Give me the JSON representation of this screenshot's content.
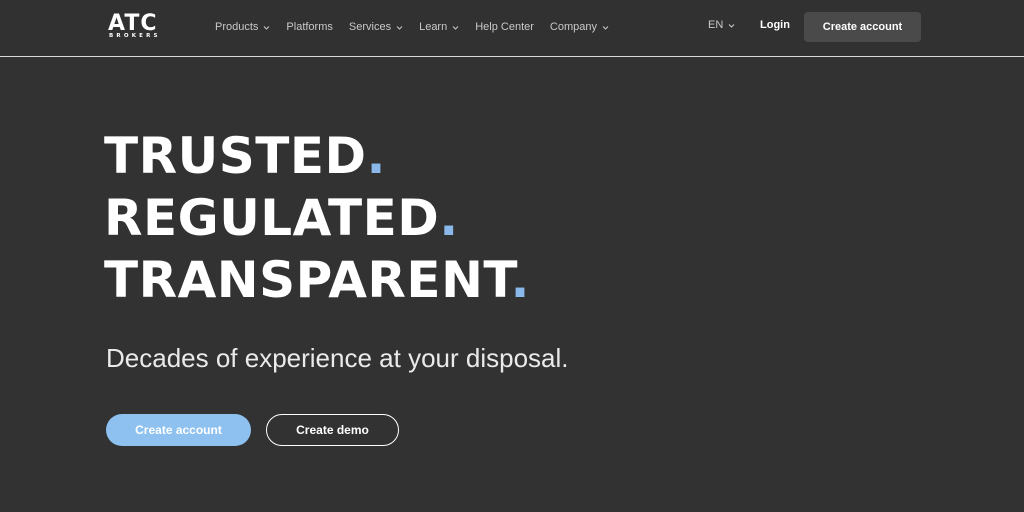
{
  "header": {
    "logo": {
      "main": "ATC",
      "sub": "BROKERS"
    },
    "nav": [
      {
        "label": "Products",
        "has_dropdown": true
      },
      {
        "label": "Platforms",
        "has_dropdown": false
      },
      {
        "label": "Services",
        "has_dropdown": true
      },
      {
        "label": "Learn",
        "has_dropdown": true
      },
      {
        "label": "Help Center",
        "has_dropdown": false
      },
      {
        "label": "Company",
        "has_dropdown": true
      }
    ],
    "language": "EN",
    "login_label": "Login",
    "cta_label": "Create account"
  },
  "hero": {
    "lines": [
      "TRUSTED",
      "REGULATED",
      "TRANSPARENT"
    ],
    "subtitle": "Decades of experience at your disposal.",
    "primary_button": "Create account",
    "secondary_button": "Create demo"
  },
  "colors": {
    "background": "#323232",
    "accent_dot": "#8ab8ea",
    "primary_button": "#8ec1ef",
    "header_button": "#4a4a4a"
  },
  "icons": {
    "dropdown": "chevron-down-icon"
  }
}
